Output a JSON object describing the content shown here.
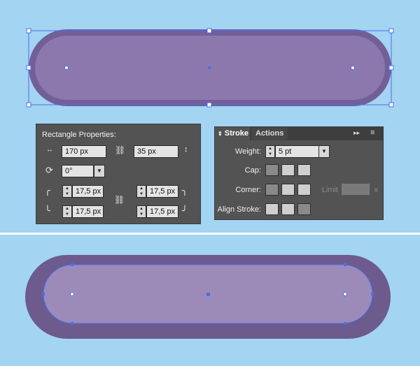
{
  "rect_properties": {
    "title": "Rectangle Properties:",
    "width": "170 px",
    "height": "35 px",
    "rotation": "0°",
    "corner_top_left": "17,5 px",
    "corner_top_right": "17,5 px",
    "corner_bottom_left": "17,5 px",
    "corner_bottom_right": "17,5 px"
  },
  "stroke_panel": {
    "tab_stroke": "Stroke",
    "tab_actions": "Actions",
    "weight_label": "Weight:",
    "weight_value": "5 pt",
    "cap_label": "Cap:",
    "corner_label": "Corner:",
    "limit_label": "Limit",
    "limit_suffix": "x",
    "align_label": "Align Stroke:"
  },
  "colors": {
    "background": "#a3d4f2",
    "shape_fill_top": "#8c78ad",
    "shape_stroke_top": "#735f98",
    "shape_fill_bottom": "#9c8bb8",
    "shape_stroke_bottom": "#6c5b8c",
    "selection": "#4a6ef0"
  }
}
